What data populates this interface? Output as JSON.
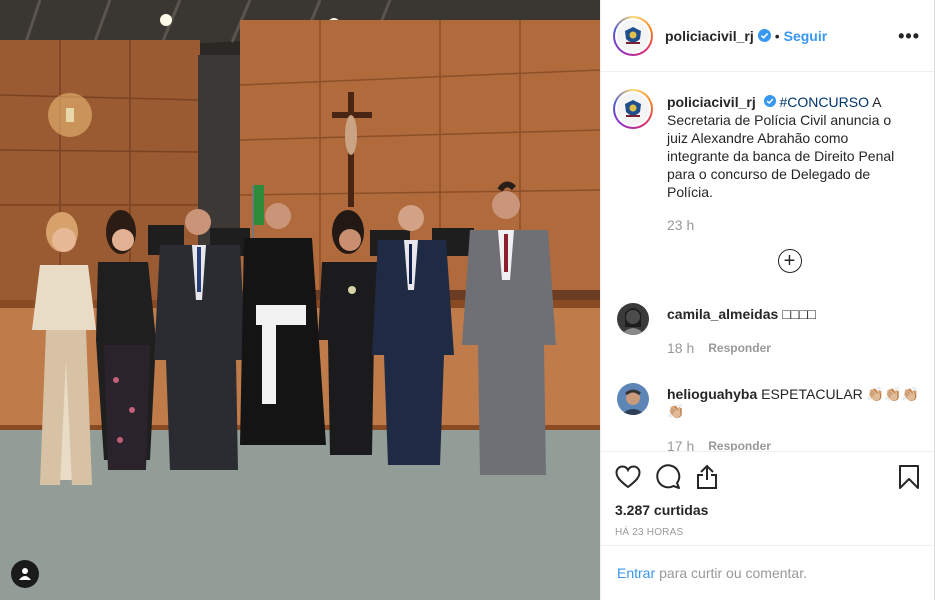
{
  "post": {
    "author": "policiacivil_rj",
    "follow_label": "Seguir",
    "dot": "•",
    "more_label": "•••",
    "caption": {
      "hashtag": "#CONCURSO",
      "text": " A Secretaria de Polícia Civil anuncia o juiz Alexandre Abrahão como integrante da banca de Direito Penal para o concurso de Delegado de Polícia.",
      "time": "23 h"
    },
    "load_more_label": "+",
    "comments": [
      {
        "user": "camila_almeidas",
        "text": "□□□□",
        "time": "18 h",
        "reply_label": "Responder"
      },
      {
        "user": "helioguahyba",
        "text": "ESPETACULAR 👏🏼👏🏼👏🏼👏🏼",
        "time": "17 h",
        "reply_label": "Responder"
      }
    ],
    "likes": "3.287 curtidas",
    "posted": "HÁ 23 HORAS",
    "login_link": "Entrar",
    "login_prompt": "para curtir ou comentar."
  },
  "colors": {
    "link": "#3897f0",
    "hashtag": "#003569",
    "muted": "#999999",
    "verified": "#3897f0"
  },
  "icons": [
    "verified-badge-icon",
    "heart-icon",
    "comment-icon",
    "share-icon",
    "bookmark-icon",
    "user-tag-icon",
    "plus-circle-icon"
  ]
}
